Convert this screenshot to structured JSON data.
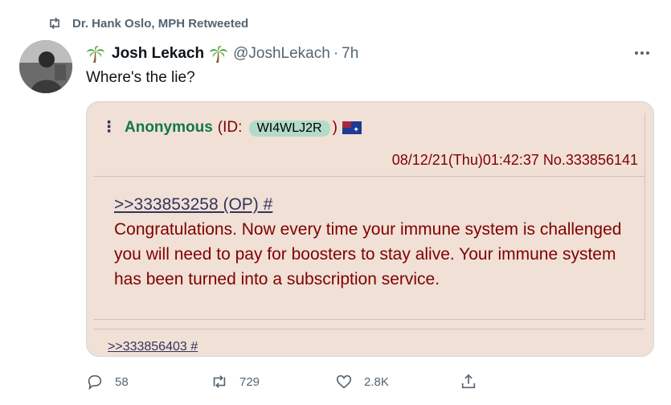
{
  "retweet": {
    "label": "Dr. Hank Oslo, MPH Retweeted",
    "icon": "retweet-icon"
  },
  "author": {
    "name": "Josh Lekach",
    "handle": "@JoshLekach",
    "separator": "·",
    "time": "7h"
  },
  "tweet": {
    "text": "Where's the lie?"
  },
  "media": {
    "menu_dots": "⋮",
    "poster_name": "Anonymous",
    "id_prefix": "(ID:",
    "id_value": "WI4WLJ2R",
    "id_suffix": ")",
    "datetime": "08/12/21(Thu)01:42:37 No.333856141",
    "quote_link": ">>333853258 (OP) #",
    "body": "Congratulations. Now every time your immune system is challenged you will need to pay for boosters to stay alive. Your immune system has been turned into a subscription service.",
    "bottom_link": ">>333856403 #"
  },
  "actions": {
    "reply_count": "58",
    "retweet_count": "729",
    "like_count": "2.8K"
  },
  "colors": {
    "greentext_name": "#117743",
    "maroon": "#800000",
    "post_bg": "#f0e0d6",
    "link": "#34345c",
    "muted": "#536471"
  }
}
